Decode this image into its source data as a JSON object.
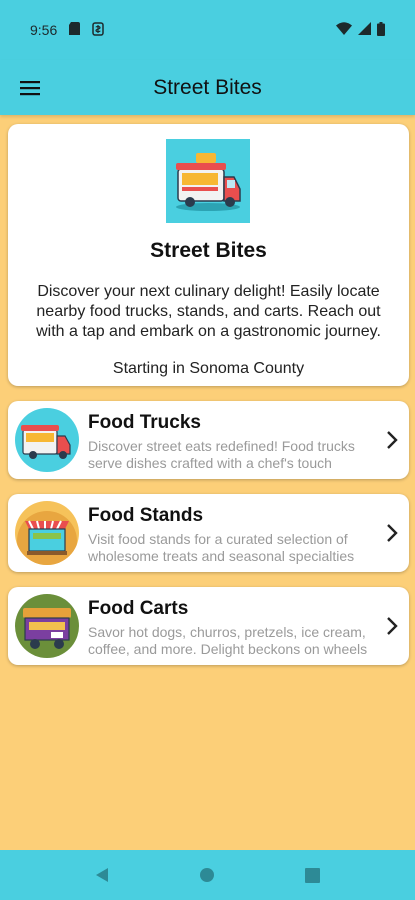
{
  "status": {
    "time": "9:56"
  },
  "app_bar": {
    "title": "Street Bites"
  },
  "hero": {
    "title": "Street Bites",
    "description": "Discover your next culinary delight! Easily locate nearby food trucks, stands, and carts. Reach out with a tap and embark on a gastronomic journey.",
    "footer": "Starting in Sonoma County"
  },
  "items": [
    {
      "title": "Food Trucks",
      "description": "Discover street eats redefined! Food trucks serve dishes crafted with a chef's touch"
    },
    {
      "title": "Food Stands",
      "description": "Visit food stands for a curated selection of wholesome treats and seasonal specialties"
    },
    {
      "title": "Food Carts",
      "description": "Savor hot dogs, churros, pretzels, ice cream, coffee, and more. Delight beckons on wheels"
    }
  ],
  "colors": {
    "accent": "#4ACFE0",
    "background": "#FCCF78"
  }
}
